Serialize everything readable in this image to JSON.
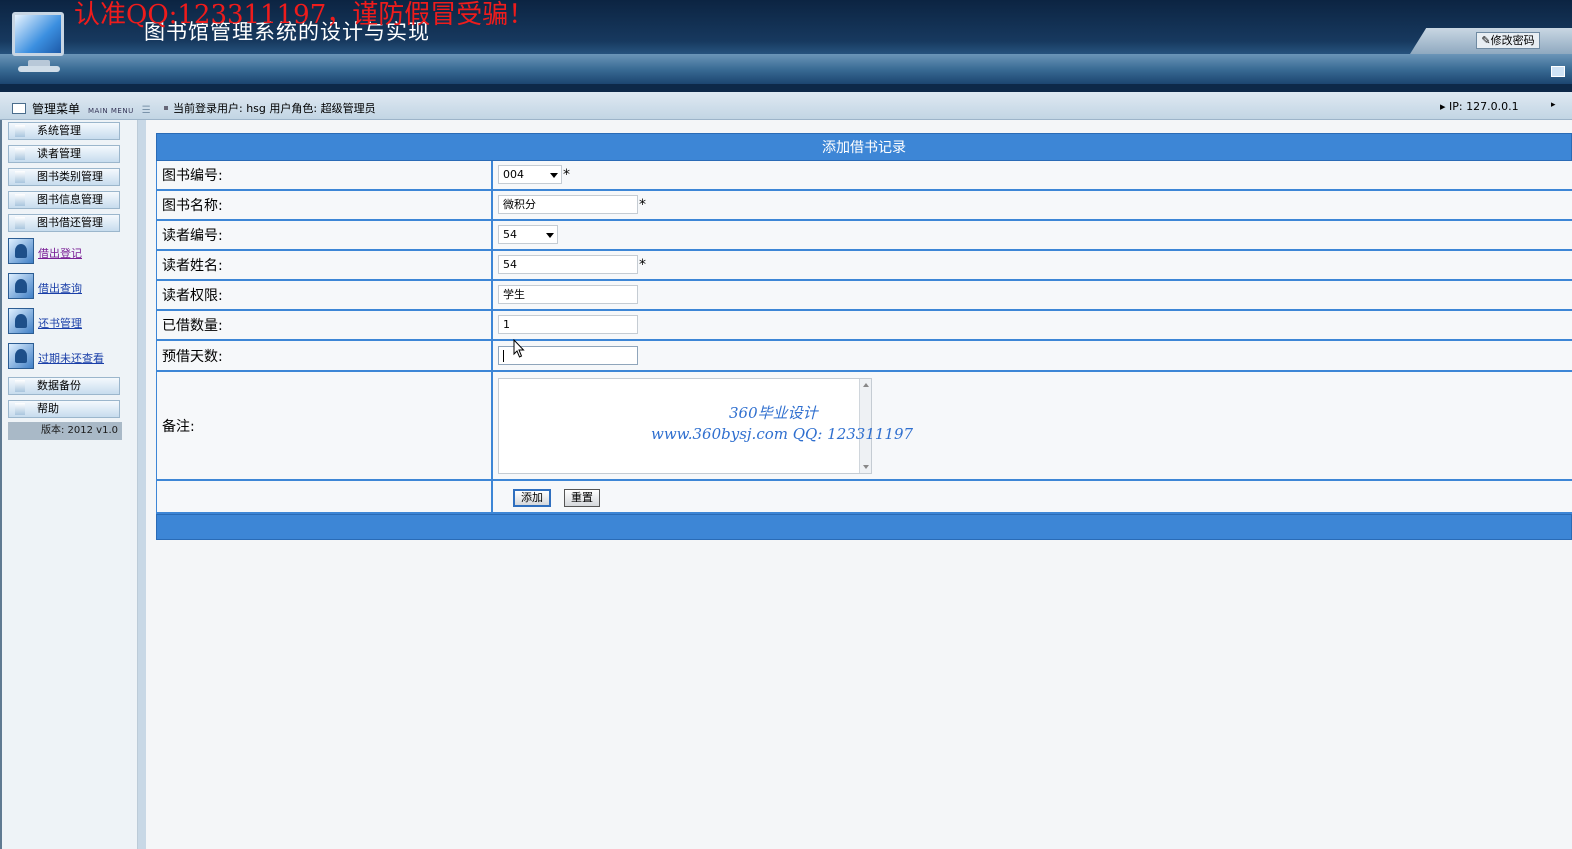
{
  "header": {
    "system_title": "图书馆管理系统的设计与实现",
    "warning": "认准QQ:123311197，谨防假冒受骗！",
    "change_password": "修改密码"
  },
  "statusbar": {
    "menu_title": "管理菜单",
    "menu_en": "MAIN MENU",
    "user_text": "当前登录用户: hsg  用户角色: 超级管理员",
    "ip_text": "IP: 127.0.0.1"
  },
  "sidebar": {
    "buttons_top": [
      "系统管理",
      "读者管理",
      "图书类别管理",
      "图书信息管理",
      "图书借还管理"
    ],
    "links": [
      "借出登记",
      "借出查询",
      "还书管理",
      "过期未还查看"
    ],
    "buttons_bottom": [
      "数据备份",
      "帮助"
    ],
    "version": "版本: 2012 v1.0"
  },
  "form": {
    "title": "添加借书记录",
    "fields": {
      "book_no": {
        "label": "图书编号:",
        "value": "004"
      },
      "book_name": {
        "label": "图书名称:",
        "value": "微积分"
      },
      "reader_no": {
        "label": "读者编号:",
        "value": "54"
      },
      "reader_name": {
        "label": "读者姓名:",
        "value": "54"
      },
      "reader_role": {
        "label": "读者权限:",
        "value": "学生"
      },
      "borrowed_count": {
        "label": "已借数量:",
        "value": "1"
      },
      "days": {
        "label": "预借天数:",
        "value": ""
      },
      "remark": {
        "label": "备注:",
        "value": ""
      }
    },
    "required_mark": "*",
    "add_button": "添加",
    "reset_button": "重置"
  },
  "watermark": {
    "line1": "360毕业设计",
    "line2": "www.360bysj.com      QQ:   123311197"
  }
}
